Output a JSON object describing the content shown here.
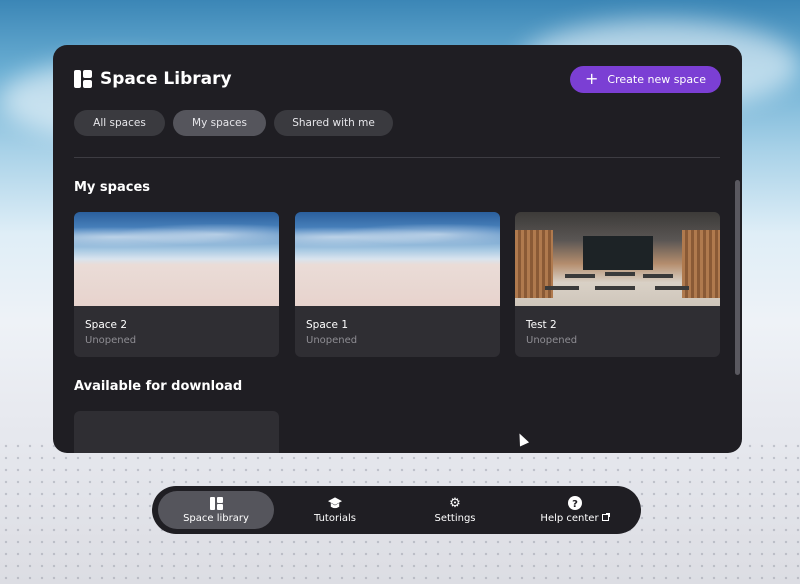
{
  "panel": {
    "title": "Space Library",
    "create_button_label": "Create new space",
    "tabs": [
      {
        "label": "All spaces",
        "active": false
      },
      {
        "label": "My spaces",
        "active": true
      },
      {
        "label": "Shared with me",
        "active": false
      }
    ],
    "sections": {
      "my_spaces_title": "My spaces",
      "download_title": "Available for download"
    },
    "spaces": [
      {
        "name": "Space 2",
        "status": "Unopened",
        "thumbnail": "sky"
      },
      {
        "name": "Space 1",
        "status": "Unopened",
        "thumbnail": "sky"
      },
      {
        "name": "Test 2",
        "status": "Unopened",
        "thumbnail": "classroom"
      }
    ]
  },
  "dock": {
    "items": [
      {
        "label": "Space library",
        "icon": "library-icon",
        "active": true
      },
      {
        "label": "Tutorials",
        "icon": "graduation-cap-icon",
        "active": false
      },
      {
        "label": "Settings",
        "icon": "gear-icon",
        "active": false
      },
      {
        "label": "Help center",
        "icon": "help-icon",
        "active": false
      }
    ]
  },
  "colors": {
    "accent": "#7b3fd4",
    "panel_bg": "#1f1e23",
    "card_bg": "#2f2e33"
  }
}
